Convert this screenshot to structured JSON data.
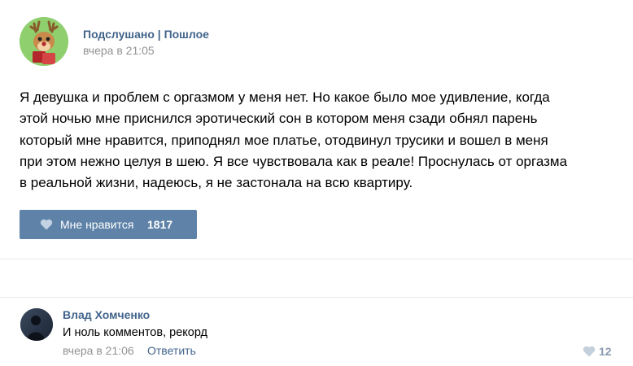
{
  "post": {
    "group_name": "Подслушано | Пошлое",
    "time": "вчера в 21:05",
    "text_lines": [
      "Я девушка и проблем с оргазмом у меня нет. Но какое было мое удивление, когда",
      "этой ночью мне приснился эротический сон в котором меня сзади обнял парень",
      "который мне нравится, приподнял мое платье, отодвинул трусики и вошел в меня",
      "при этом нежно целуя в шею. Я все чувствовала как в реале! Проснулась от оргазма",
      "в реальной жизни, надеюсь, я не застонала на всю квартиру."
    ],
    "like_label": "Мне нравится",
    "like_count": "1817"
  },
  "comment": {
    "author": "Влад Хомченко",
    "text": "И ноль комментов, рекорд",
    "time": "вчера в 21:06",
    "reply_label": "Ответить",
    "like_count": "12"
  },
  "icons": {
    "group_avatar": "deer-avatar-icon",
    "like": "heart-icon",
    "comment_avatar": "user-photo-avatar"
  },
  "colors": {
    "link": "#42648b",
    "button": "#5e82a8",
    "muted": "#939393"
  }
}
